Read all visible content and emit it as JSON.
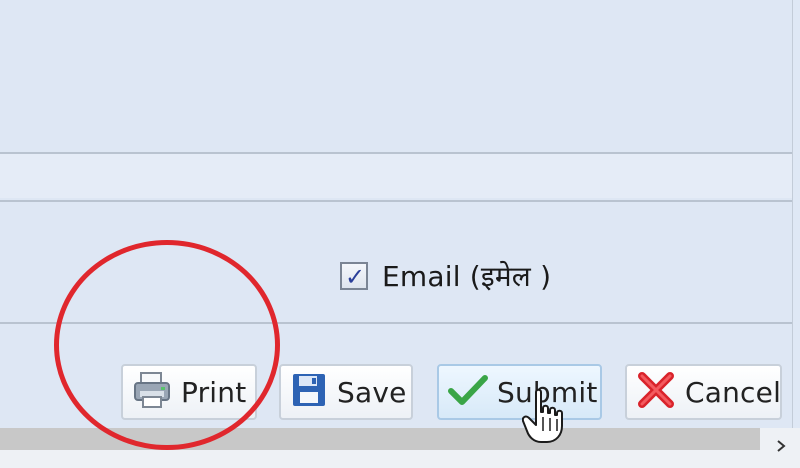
{
  "form": {
    "email_option": {
      "label": "Email (इमेल )",
      "checked": true
    }
  },
  "buttons": {
    "print": "Print",
    "save": "Save",
    "submit": "Submit",
    "cancel": "Cancel"
  },
  "icons": {
    "print": "printer-icon",
    "save": "floppy-disk-icon",
    "submit": "checkmark-icon",
    "cancel": "red-x-icon",
    "cursor": "hand-pointer-icon",
    "scroll_right": "chevron-right-icon"
  },
  "colors": {
    "annotation": "#e0272d",
    "submit_check": "#3aa547",
    "cancel_x": "#d9232b",
    "save_blue": "#2d63b4"
  }
}
